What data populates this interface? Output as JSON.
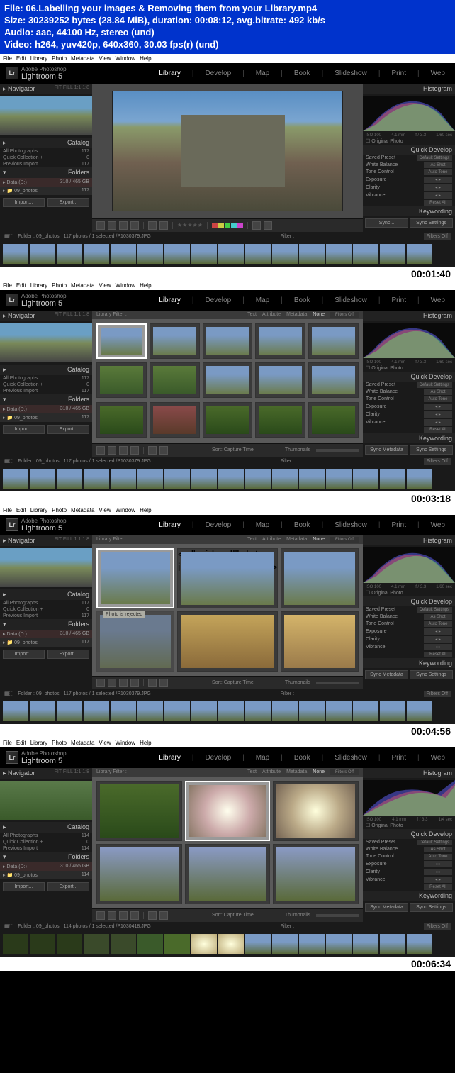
{
  "info": {
    "file_line": "File: 06.Labelling your images & Removing them from your Library.mp4",
    "size_line": "Size: 30239252 bytes (28.84 MiB), duration: 00:08:12, avg.bitrate: 492 kb/s",
    "audio_line": "Audio: aac, 44100 Hz, stereo (und)",
    "video_line": "Video: h264, yuv420p, 640x360, 30.03 fps(r) (und)"
  },
  "menu": {
    "items": [
      "File",
      "Edit",
      "Library",
      "Photo",
      "Metadata",
      "View",
      "Window",
      "Help"
    ]
  },
  "logo": {
    "lr": "Lr",
    "brand": "Adobe Photoshop",
    "product": "Lightroom 5"
  },
  "modules": {
    "items": [
      "Library",
      "Develop",
      "Map",
      "Book",
      "Slideshow",
      "Print",
      "Web"
    ],
    "active": "Library"
  },
  "nav": {
    "title": "Navigator",
    "opts": "FIT   FILL   1:1   1:8"
  },
  "catalog": {
    "title": "Catalog",
    "items": [
      {
        "name": "All Photographs",
        "count": "117"
      },
      {
        "name": "Quick Collection +",
        "count": "0"
      },
      {
        "name": "Previous Import",
        "count": "117"
      }
    ]
  },
  "folders": {
    "title": "Folders",
    "drive": "Data (D:)",
    "drive_info": "310 / 465 GB",
    "folder": "09_photos",
    "folder_count": "117"
  },
  "buttons": {
    "import": "Import...",
    "export": "Export..."
  },
  "histo": {
    "title": "Histogram",
    "iso": "ISO 100",
    "focal": "4.1 mm",
    "ap": "f / 3.3",
    "sh": "1/60 sec",
    "orig": "Original Photo"
  },
  "qd": {
    "title": "Quick Develop",
    "saved_preset": "Saved Preset",
    "preset_val": "Default Settings",
    "wb": "White Balance",
    "wb_val": "As Shot",
    "tone": "Tone Control",
    "tone_val": "Auto Tone",
    "exposure": "Exposure",
    "clarity": "Clarity",
    "vibrance": "Vibrance",
    "reset": "Reset All"
  },
  "keywording": {
    "title": "Keywording"
  },
  "sync": {
    "sync": "Sync...",
    "sync_settings": "Sync Settings",
    "sync_meta": "Sync Metadata"
  },
  "lib_filter": {
    "label": "Library Filter :",
    "text": "Text",
    "attr": "Attribute",
    "meta": "Metadata",
    "none": "None",
    "filters_off": "Filters Off"
  },
  "sort": {
    "label": "Sort:",
    "value": "Capture Time",
    "thumbs": "Thumbnails"
  },
  "filmstrip": {
    "folder": "Folder : 09_photos",
    "count": "117 photos / 1 selected /",
    "filename": "P1030379.JPG",
    "filter": "Filter :",
    "filters_off": "Filters Off"
  },
  "tooltip": {
    "reject": "Photo is rejected"
  },
  "timestamps": [
    "00:01:40",
    "00:03:18",
    "00:04:56",
    "00:06:34"
  ],
  "shot3_count": "117 photos / 1 selected /",
  "shot4": {
    "count": "114 photos / 1 selected /",
    "filename": "P1030418.JPG",
    "cat_all": "114",
    "cat_prev": "114",
    "histo_sh": "1/4 sec"
  },
  "colors": [
    "#c44",
    "#cc4",
    "#4c4",
    "#4cc",
    "#44c",
    "#c4c"
  ]
}
